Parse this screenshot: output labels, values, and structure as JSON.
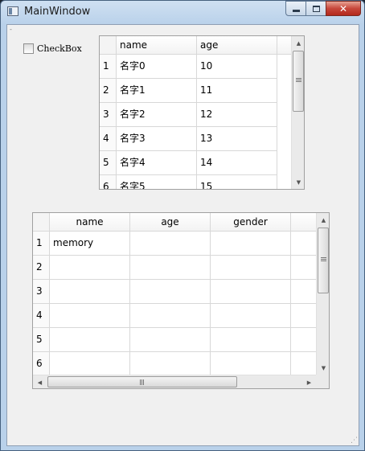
{
  "window": {
    "title": "MainWindow",
    "menu_stub": "-"
  },
  "caption_buttons": [
    "minimize",
    "maximize",
    "close"
  ],
  "checkbox": {
    "label": "CheckBox",
    "checked": false
  },
  "table1": {
    "headers": [
      "name",
      "age"
    ],
    "rows": [
      {
        "num": "1",
        "name": "名字0",
        "age": "10"
      },
      {
        "num": "2",
        "name": "名字1",
        "age": "11"
      },
      {
        "num": "3",
        "name": "名字2",
        "age": "12"
      },
      {
        "num": "4",
        "name": "名字3",
        "age": "13"
      },
      {
        "num": "5",
        "name": "名字4",
        "age": "14"
      },
      {
        "num": "6",
        "name": "名字5",
        "age": "15"
      }
    ]
  },
  "table2": {
    "headers": [
      "name",
      "age",
      "gender"
    ],
    "rows": [
      {
        "num": "1",
        "name": "memory",
        "age": "",
        "gender": ""
      },
      {
        "num": "2",
        "name": "",
        "age": "",
        "gender": ""
      },
      {
        "num": "3",
        "name": "",
        "age": "",
        "gender": ""
      },
      {
        "num": "4",
        "name": "",
        "age": "",
        "gender": ""
      },
      {
        "num": "5",
        "name": "",
        "age": "",
        "gender": ""
      },
      {
        "num": "6",
        "name": "",
        "age": "",
        "gender": ""
      }
    ]
  }
}
